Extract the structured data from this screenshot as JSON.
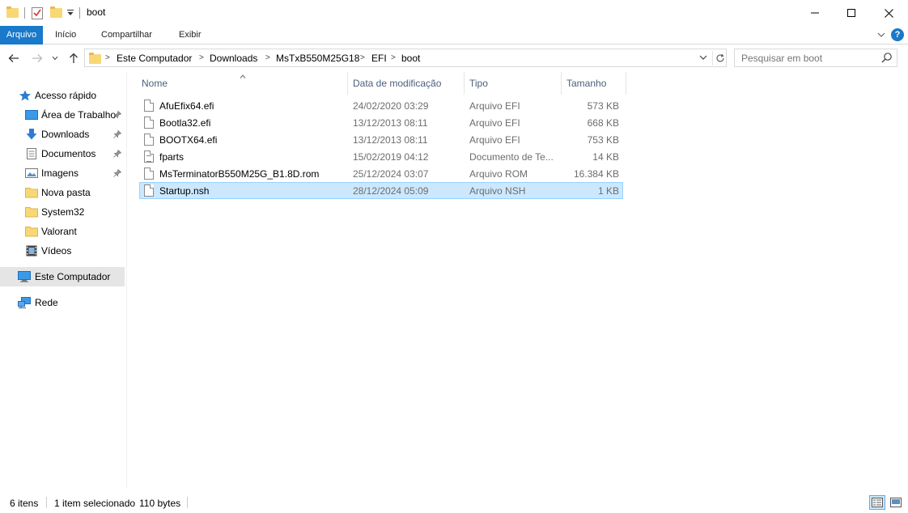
{
  "window": {
    "title": "boot"
  },
  "ribbon": {
    "tabs": [
      "Arquivo",
      "Início",
      "Compartilhar",
      "Exibir"
    ],
    "help": "?"
  },
  "address": {
    "crumbs": [
      "Este Computador",
      "Downloads",
      "MsTxB550M25G18",
      "EFI",
      "boot"
    ]
  },
  "search": {
    "placeholder": "Pesquisar em boot"
  },
  "sidebar": {
    "quick_access": "Acesso rápido",
    "items": [
      {
        "label": "Área de Trabalho",
        "icon": "desktop-icon",
        "pinned": true
      },
      {
        "label": "Downloads",
        "icon": "download-arrow-icon",
        "pinned": true
      },
      {
        "label": "Documentos",
        "icon": "document-icon",
        "pinned": true
      },
      {
        "label": "Imagens",
        "icon": "image-icon",
        "pinned": true
      },
      {
        "label": "Nova pasta",
        "icon": "folder-icon",
        "pinned": false
      },
      {
        "label": "System32",
        "icon": "folder-icon",
        "pinned": false
      },
      {
        "label": "Valorant",
        "icon": "folder-icon",
        "pinned": false
      },
      {
        "label": "Vídeos",
        "icon": "film-icon",
        "pinned": false
      }
    ],
    "this_pc": "Este Computador",
    "network": "Rede"
  },
  "columns": {
    "name": "Nome",
    "date": "Data de modificação",
    "type": "Tipo",
    "size": "Tamanho"
  },
  "files": [
    {
      "name": "AfuEfix64.efi",
      "date": "24/02/2020 03:29",
      "type": "Arquivo EFI",
      "size": "573 KB",
      "icon": "file-icon",
      "selected": false
    },
    {
      "name": "Bootla32.efi",
      "date": "13/12/2013 08:11",
      "type": "Arquivo EFI",
      "size": "668 KB",
      "icon": "file-icon",
      "selected": false
    },
    {
      "name": "BOOTX64.efi",
      "date": "13/12/2013 08:11",
      "type": "Arquivo EFI",
      "size": "753 KB",
      "icon": "file-icon",
      "selected": false
    },
    {
      "name": "fparts",
      "date": "15/02/2019 04:12",
      "type": "Documento de Te...",
      "size": "14 KB",
      "icon": "text-file-icon",
      "selected": false
    },
    {
      "name": "MsTerminatorB550M25G_B1.8D.rom",
      "date": "25/12/2024 03:07",
      "type": "Arquivo ROM",
      "size": "16.384 KB",
      "icon": "file-icon",
      "selected": false
    },
    {
      "name": "Startup.nsh",
      "date": "28/12/2024 05:09",
      "type": "Arquivo NSH",
      "size": "1 KB",
      "icon": "file-icon",
      "selected": true
    }
  ],
  "status": {
    "count": "6 itens",
    "selection": "1 item selecionado",
    "bytes": "110 bytes"
  },
  "colors": {
    "accent": "#1979ca",
    "selection_bg": "#cce8ff",
    "selection_border": "#99d1ff",
    "header_text": "#4c607a",
    "folder": "#f8d775"
  }
}
